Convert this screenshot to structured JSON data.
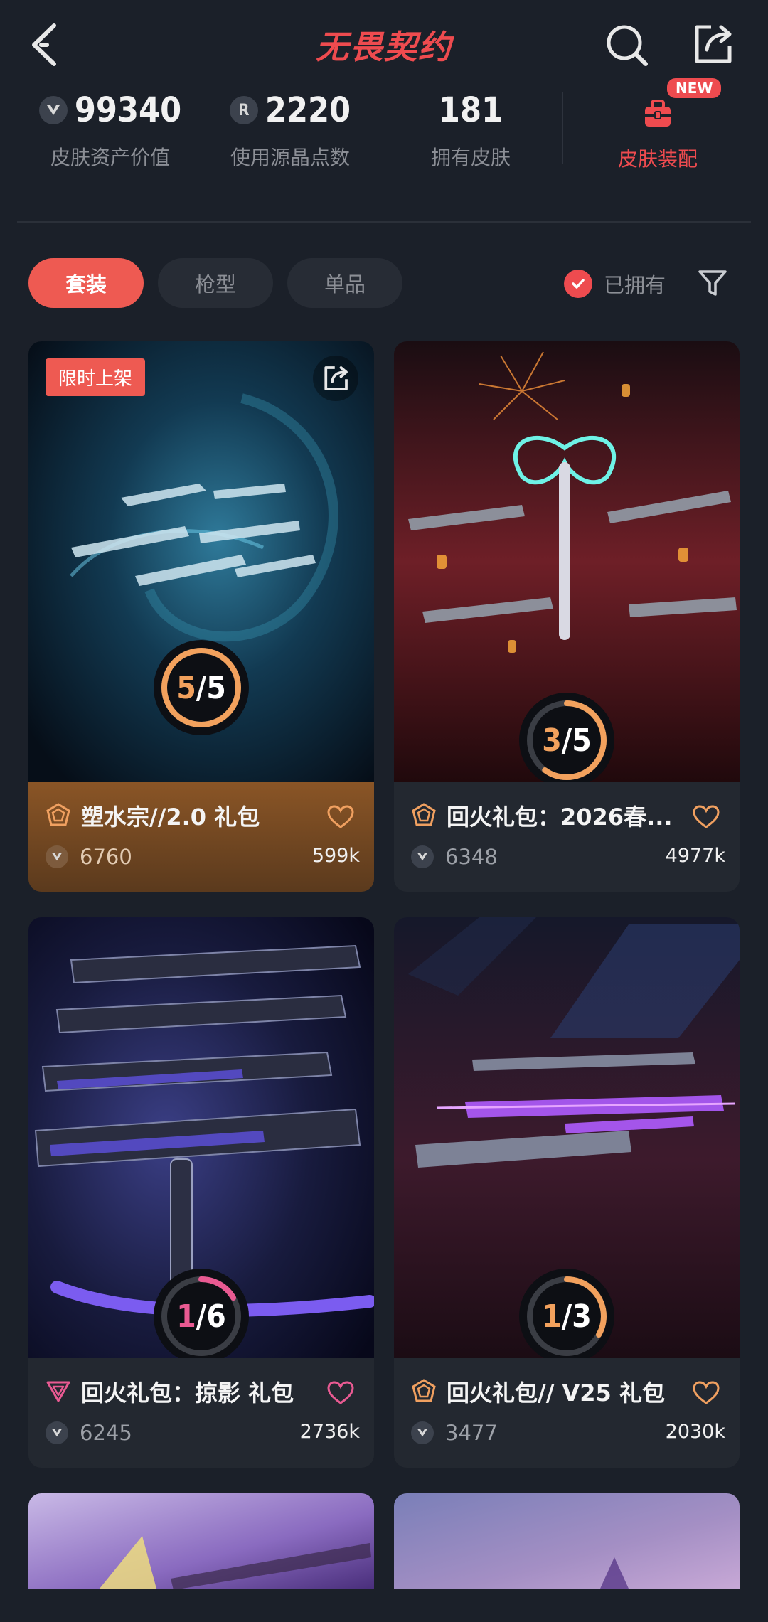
{
  "header": {
    "title": "无畏契约"
  },
  "stats": [
    {
      "value": "99340",
      "label": "皮肤资产价值",
      "icon": "valorant-points-icon"
    },
    {
      "value": "2220",
      "label": "使用源晶点数",
      "icon": "radianite-icon",
      "icon_text": "R"
    },
    {
      "value": "181",
      "label": "拥有皮肤"
    }
  ],
  "equip": {
    "label": "皮肤装配",
    "badge": "NEW"
  },
  "tabs": [
    {
      "label": "套装",
      "active": true
    },
    {
      "label": "枪型",
      "active": false
    },
    {
      "label": "单品",
      "active": false
    }
  ],
  "filter": {
    "owned_label": "已拥有",
    "owned_checked": true
  },
  "cards": [
    {
      "title": "塑水宗//2.0 礼包",
      "owned": "5",
      "total": "5",
      "progress": 1.0,
      "price": "6760",
      "likes": "599k",
      "tag": "限时上架",
      "theme": "gold",
      "tier_color": "#f0a060"
    },
    {
      "title": "回火礼包：2026春...",
      "owned": "3",
      "total": "5",
      "progress": 0.6,
      "price": "6348",
      "likes": "4977k",
      "theme": "dark",
      "tier_color": "#f0a060"
    },
    {
      "title": "回火礼包：掠影 礼包",
      "owned": "1",
      "total": "6",
      "progress": 0.1667,
      "price": "6245",
      "likes": "2736k",
      "theme": "dark",
      "tier_color": "#e95a92"
    },
    {
      "title": "回火礼包// V25 礼包",
      "owned": "1",
      "total": "3",
      "progress": 0.3333,
      "price": "3477",
      "likes": "2030k",
      "theme": "dark",
      "tier_color": "#f0a060"
    }
  ],
  "colors": {
    "accent": "#ee4b4f",
    "ring_orange": "#f2a15d",
    "ring_pink": "#e95a92"
  }
}
